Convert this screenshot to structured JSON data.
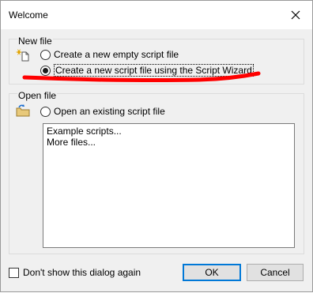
{
  "window": {
    "title": "Welcome"
  },
  "new_file": {
    "label": "New file",
    "option_empty": "Create a new empty script file",
    "option_wizard": "Create a new script file using the Script Wizard"
  },
  "open_file": {
    "label": "Open file",
    "option_existing": "Open an existing script file",
    "list_items": [
      "Example scripts...",
      "More files..."
    ]
  },
  "footer": {
    "dont_show_label": "Don't show this dialog again",
    "ok_label": "OK",
    "cancel_label": "Cancel"
  },
  "colors": {
    "annotation": "#ff0000",
    "default_button_border": "#0078d7"
  },
  "icons": [
    "close-icon",
    "new-file-icon",
    "open-file-icon"
  ]
}
